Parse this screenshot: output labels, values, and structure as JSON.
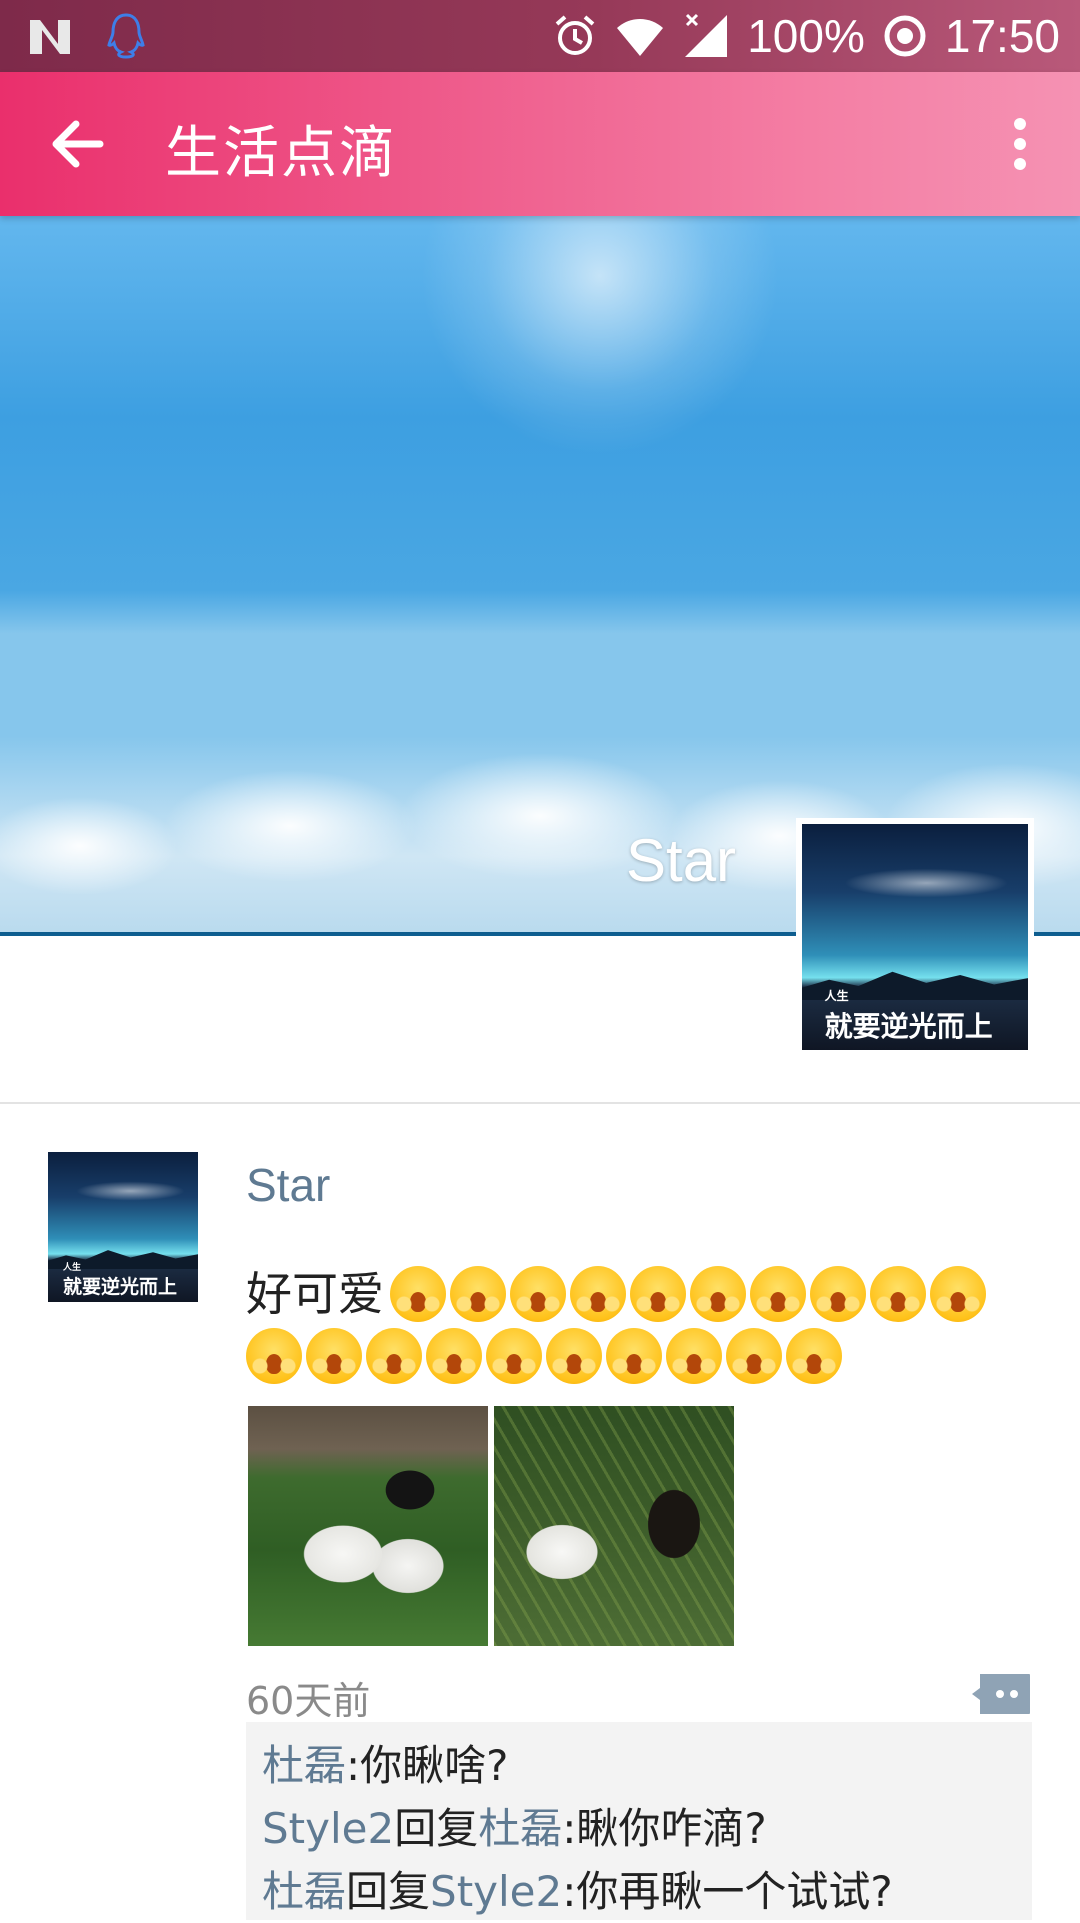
{
  "status_bar": {
    "battery": "100%",
    "time": "17:50"
  },
  "app_bar": {
    "title": "生活点滴"
  },
  "cover": {
    "user_name": "Star",
    "avatar_text_small": "人生",
    "avatar_text_big": "就要逆光而上"
  },
  "post": {
    "author": "Star",
    "text": "好可爱",
    "emoji_row1_count": 10,
    "emoji_row2_count": 10,
    "time": "60天前",
    "photos": [
      "rabbits-photo-1",
      "rabbits-photo-2"
    ]
  },
  "comments": [
    {
      "user": "杜磊",
      "reply_label": "",
      "reply_to": "",
      "text": "你瞅啥?"
    },
    {
      "user": "Style2",
      "reply_label": "回复",
      "reply_to": "杜磊",
      "text": "瞅你咋滴?"
    },
    {
      "user": "杜磊",
      "reply_label": "回复",
      "reply_to": "Style2",
      "text": "你再瞅一个试试?"
    }
  ],
  "colors": {
    "app_bar_start": "#ea2f6c",
    "app_bar_end": "#f592b3",
    "link_name": "#5f7a92",
    "comment_bg": "#f3f3f3"
  }
}
